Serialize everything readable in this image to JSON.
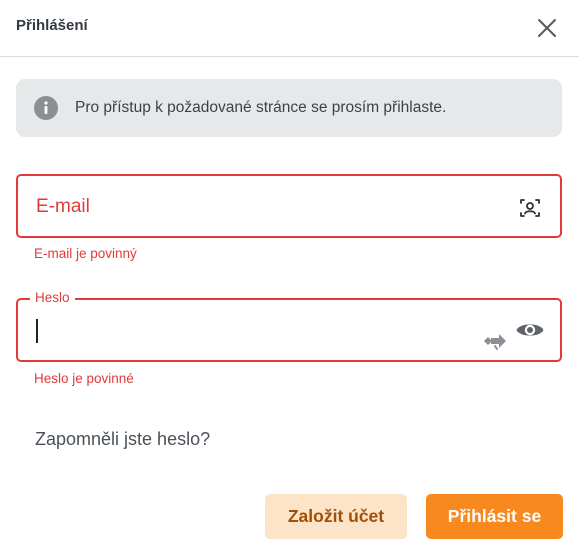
{
  "dialog": {
    "title": "Přihlášení",
    "close_icon": "close-icon"
  },
  "info": {
    "icon": "info-icon",
    "text": "Pro přístup k požadované stránce se prosím přihlaste."
  },
  "email": {
    "placeholder": "E-mail",
    "value": "",
    "icon": "contact-card-icon",
    "error": "E-mail je povinný"
  },
  "password": {
    "label": "Heslo",
    "value": "",
    "autofill_icon": "autofill-key-icon",
    "toggle_icon": "eye-icon",
    "error": "Heslo je povinné"
  },
  "forgot_link": "Zapomněli jste heslo?",
  "buttons": {
    "register": "Založit účet",
    "login": "Přihlásit se"
  },
  "colors": {
    "accent": "#f7891e",
    "error": "#e23a3a",
    "secondary_bg": "#fde3c7",
    "info_bg": "#e7e8e9"
  }
}
